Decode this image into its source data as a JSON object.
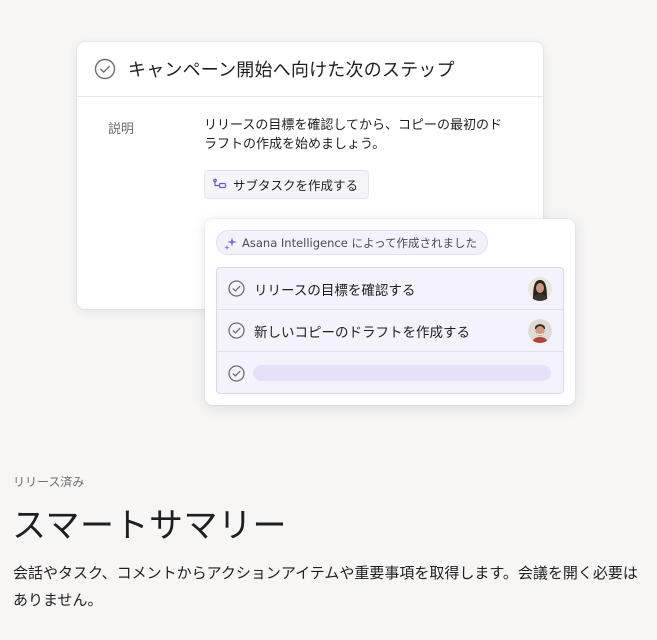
{
  "task": {
    "title": "キャンペーン開始へ向けた次のステップ",
    "description_label": "説明",
    "description": "リリースの目標を確認してから、コピーの最初のドラフトの作成を始めましょう。",
    "subtask_button_label": "サブタスクを作成する",
    "icons": {
      "complete": "check-circle-icon",
      "subtask": "subtask-icon"
    }
  },
  "ai_panel": {
    "badge_label": "Asana Intelligence によって作成されました",
    "badge_icon": "sparkle-icon",
    "items": [
      {
        "label": "リリースの目標を確認する",
        "avatar": "avatar-woman"
      },
      {
        "label": "新しいコピーのドラフトを作成する",
        "avatar": "avatar-man"
      },
      {
        "label": "",
        "avatar": ""
      }
    ],
    "colors": {
      "accent": "#7b6dd3",
      "panel_bg": "#f4f2fb"
    }
  },
  "feature": {
    "status": "リリース済み",
    "headline": "スマートサマリー",
    "body": "会話やタスク、コメントからアクションアイテムや重要事項を取得します。会議を開く必要はありません。"
  }
}
